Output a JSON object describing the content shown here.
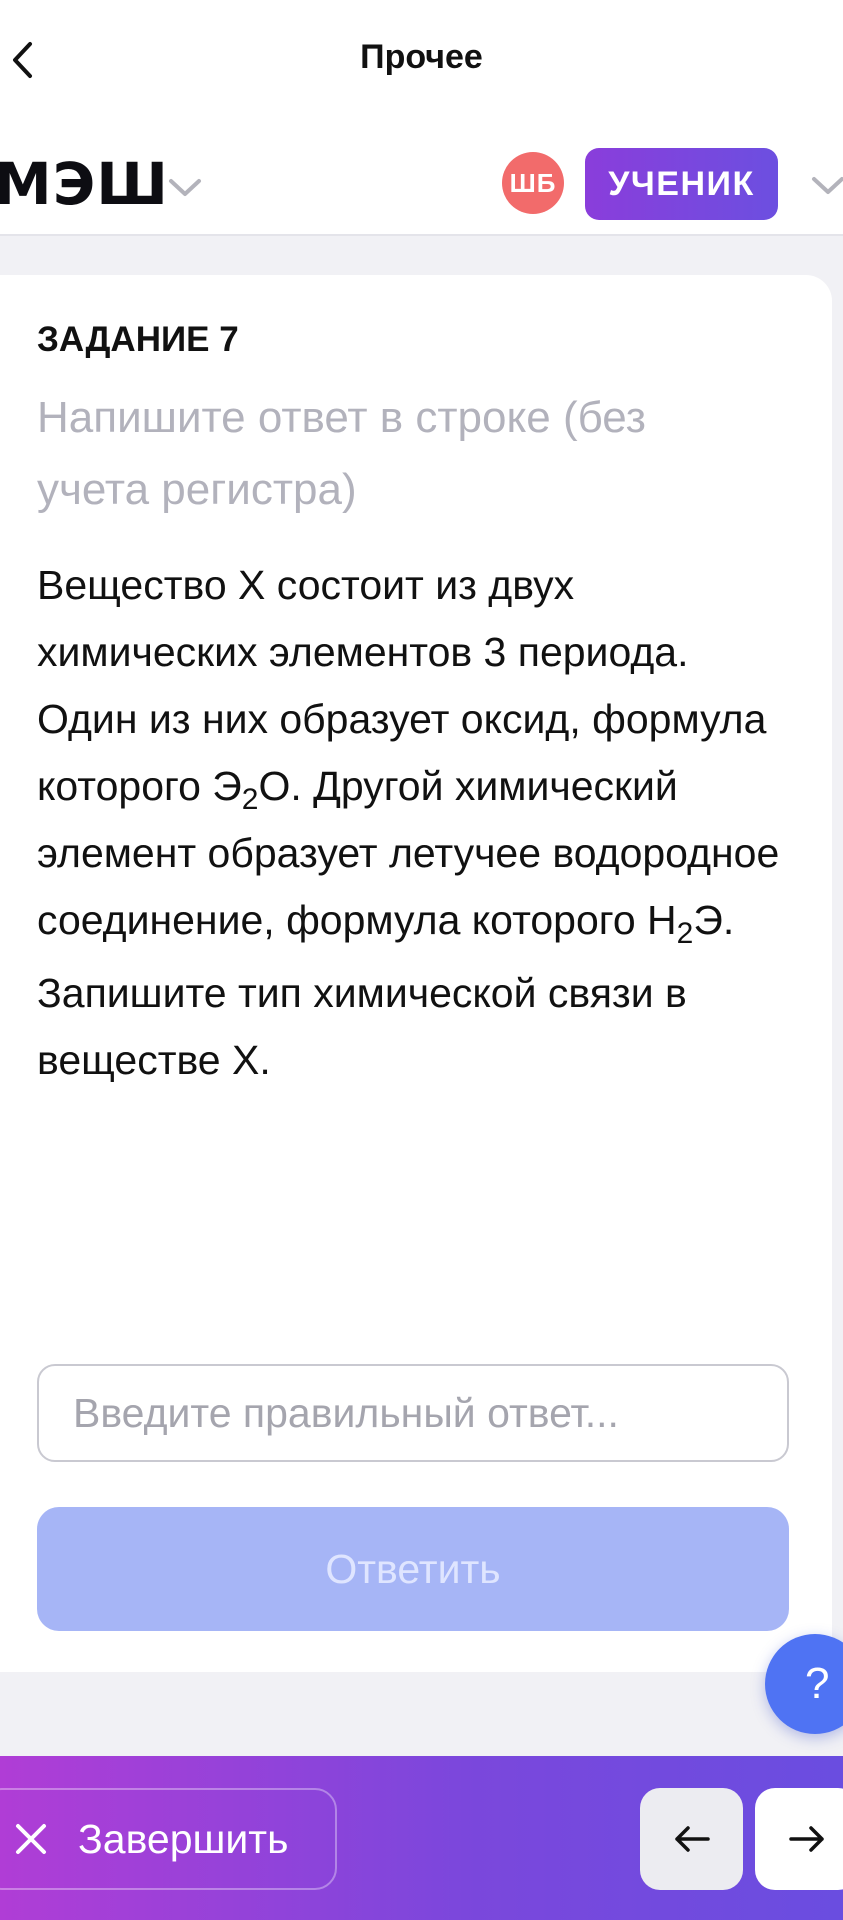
{
  "nav": {
    "title": "Прочее"
  },
  "header": {
    "brand": "МЭШ",
    "avatar_initials": "ШБ",
    "role": "УЧЕНИК"
  },
  "task": {
    "label": "ЗАДАНИЕ 7",
    "hint": "Напишите ответ в строке (без учета регистра)",
    "question": {
      "part1_before_oxide": "Вещество X состоит из двух химических элементов 3 периода. Один из них образует оксид, формула которого Э",
      "oxide_subscript": "2",
      "part1_after_oxide": "О. Другой химический элемент образует летучее водородное соединение, формула которого H",
      "hydride_subscript": "2",
      "part1_after_hydride": "Э.",
      "part2": "Запишите тип химической связи в веществе X."
    },
    "answer_placeholder": "Введите правильный ответ...",
    "answer_value": "",
    "submit_label": "Ответить"
  },
  "help": {
    "label": "?"
  },
  "footer": {
    "finish_label": "Завершить"
  },
  "colors": {
    "accent_purple": "#7b47dc",
    "avatar_red": "#f26b6b",
    "submit_disabled": "#a6b5f6",
    "help_blue": "#4f73f3"
  },
  "icons": {
    "back": "chevron-left-icon",
    "brand_dropdown": "chevron-down-icon",
    "role_dropdown": "chevron-down-icon",
    "finish": "close-icon",
    "prev": "arrow-left-icon",
    "next": "arrow-right-icon"
  }
}
